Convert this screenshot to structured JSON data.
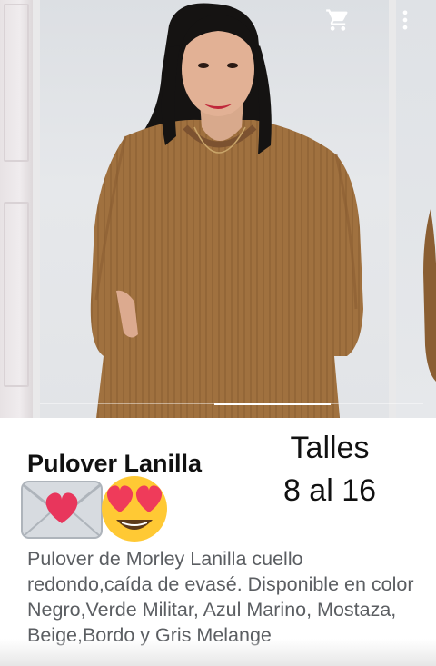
{
  "product": {
    "title": "Pulover Lanilla",
    "sizes_line1": "Talles",
    "sizes_line2": "8 al 16",
    "description": "Pulover de Morley Lanilla cuello redondo,caída de evasé. Disponible en color Negro,Verde Militar, Azul Marino, Mostaza, Beige,Bordo y Gris Melange"
  },
  "emojis": [
    "envelope-with-heart-emoji",
    "heart-eyes-emoji"
  ],
  "carousel": {
    "slide_count": 3,
    "active_slide": 2
  },
  "toolbar": {
    "icons": [
      "shopping-cart-icon",
      "more-vert-icon"
    ]
  },
  "colors": {
    "sweater": "#a0713f",
    "title_text": "#111111",
    "description_text": "#5b5e62",
    "indicator": "#ffffff"
  }
}
